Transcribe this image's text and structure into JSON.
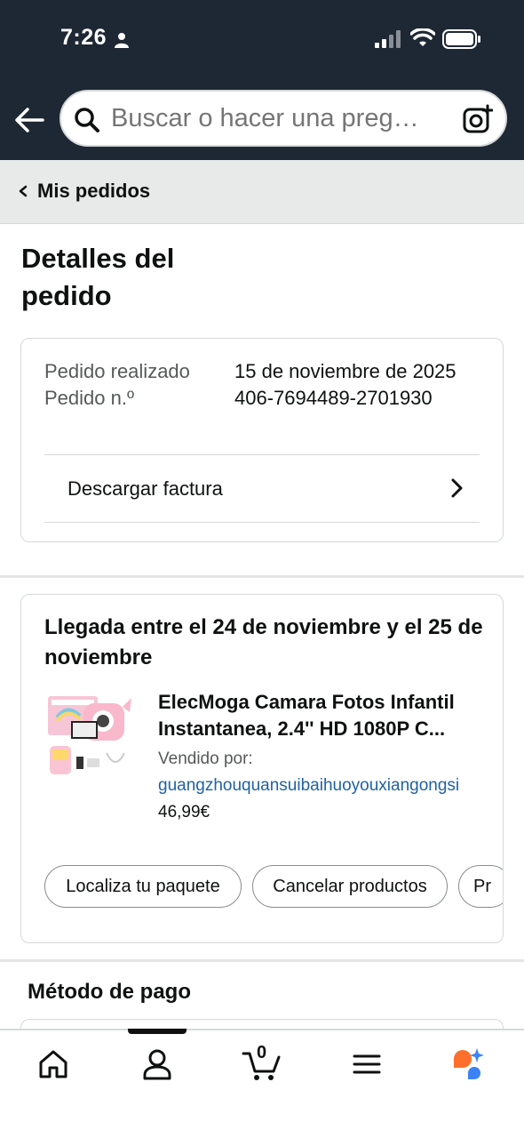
{
  "status_bar": {
    "time": "7:26"
  },
  "search": {
    "placeholder": "Buscar o hacer una preg…"
  },
  "breadcrumb": {
    "label": "Mis pedidos"
  },
  "page": {
    "title": "Detalles del pedido"
  },
  "order_summary": {
    "placed_label": "Pedido realizado",
    "number_label": "Pedido n.º",
    "placed_date": "15 de noviembre de 2025",
    "order_number": "406-7694489-2701930",
    "invoice_label": "Descargar factura"
  },
  "delivery": {
    "title": "Llegada entre el 24 de noviembre y el 25 de noviembre",
    "product_name": "ElecMoga Camara Fotos Infantil Instantanea, 2.4'' HD 1080P C...",
    "seller_label": "Vendido por:",
    "seller_name": "guangzhouquansuibaihuoyouxiangongsi",
    "price": "46,99€",
    "actions": [
      "Localiza tu paquete",
      "Cancelar productos",
      "Pr"
    ]
  },
  "payment": {
    "title": "Método de pago"
  },
  "tabbar": {
    "items": [
      "home-icon",
      "profile-icon",
      "cart-icon",
      "menu-icon",
      "rufus-icon"
    ],
    "cart_count": "0",
    "active_index": 1
  },
  "colors": {
    "header_bg": "#1e2734",
    "link": "#2162a1",
    "breadcrumb_bg": "#e8eaea",
    "rufus_orange": "#ff6f2c",
    "rufus_blue": "#3b82f6"
  }
}
